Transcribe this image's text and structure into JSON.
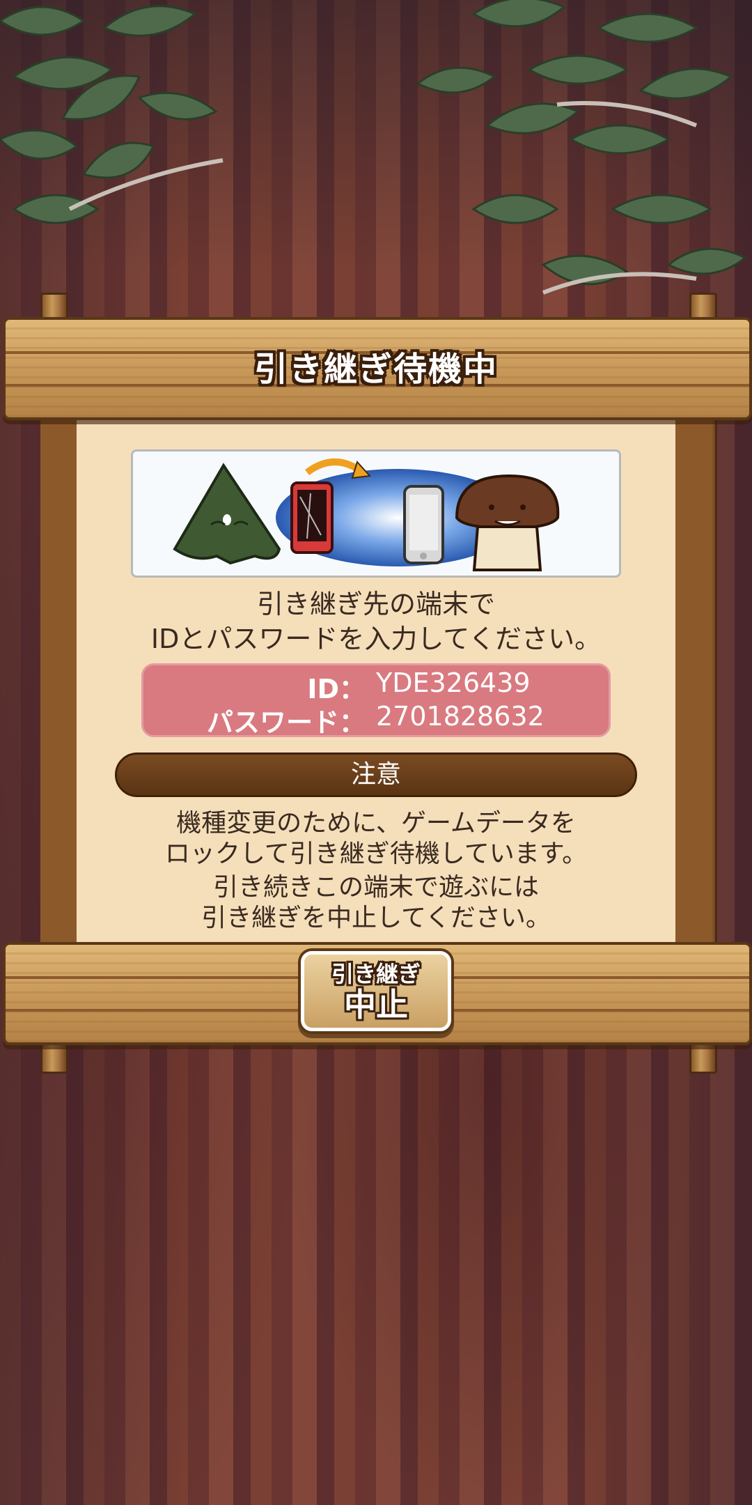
{
  "dialog": {
    "title": "引き継ぎ待機中",
    "instruction_line1": "引き継ぎ先の端末で",
    "instruction_line2": "IDとパスワードを入力してください。",
    "credentials": {
      "id_label": "ID：",
      "id_value": "YDE326439",
      "password_label": "パスワード：",
      "password_value": "2701828632"
    },
    "notice_header": "注意",
    "notice_line1": "機種変更のために、ゲームデータを",
    "notice_line2": "ロックして引き継ぎ待機しています。",
    "notice_line3": "引き続きこの端末で遊ぶには",
    "notice_line4": "引き継ぎを中止してください。",
    "cancel_button": {
      "line1": "引き継ぎ",
      "line2": "中止"
    }
  },
  "illustration": {
    "left_character": "dark-green-mushroom-character",
    "left_device": "red-phone-icon",
    "arrow": "transfer-arrow-icon",
    "right_device": "white-phone-icon",
    "right_character": "brown-mushroom-character"
  },
  "colors": {
    "panel_bg": "#f5dfbb",
    "credentials_bg": "#d97a80",
    "notice_bar": "#5b3413",
    "wood": "#c9995a"
  }
}
